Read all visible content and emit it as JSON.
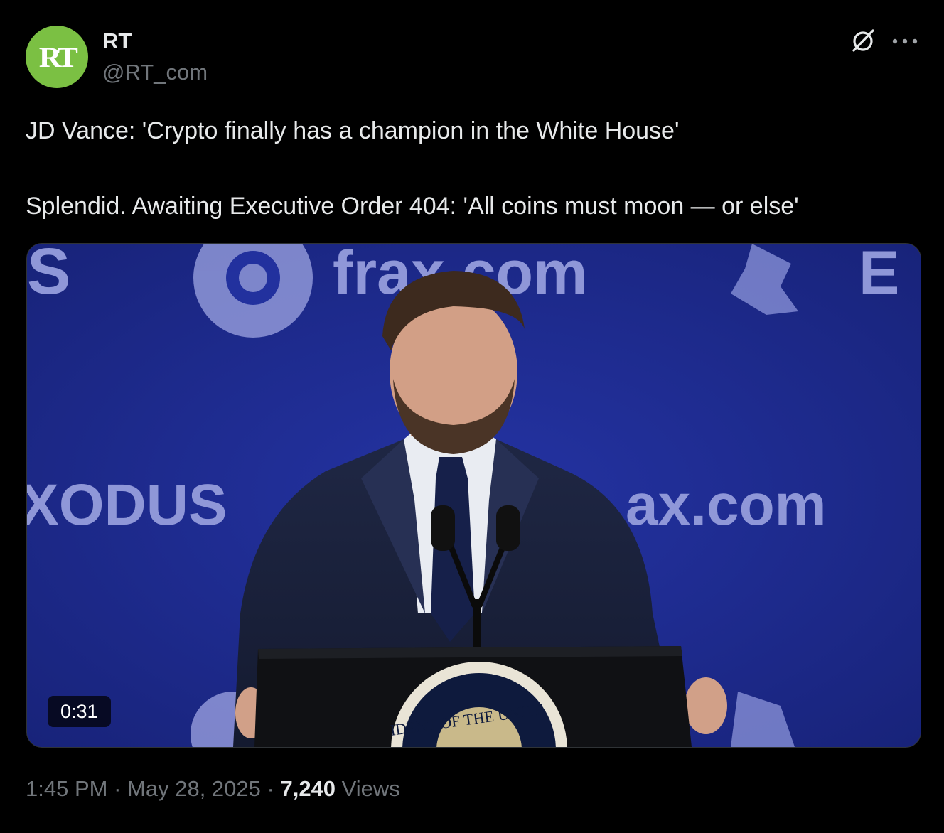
{
  "author": {
    "avatar_text": "RT",
    "name": "RT",
    "handle": "@RT_com",
    "avatar_color": "#7bc043"
  },
  "header_icons": [
    "grok-icon",
    "more-icon"
  ],
  "tweet": {
    "line1": "JD Vance: 'Crypto finally has a champion in the White House'",
    "line2": "Splendid. Awaiting Executive Order 404: 'All coins must moon — or else'"
  },
  "media": {
    "duration": "0:31",
    "backdrop_color": "#1e2b8c",
    "backdrop_texts": {
      "top_left": "S",
      "top_center": "frax.com",
      "top_right": "E",
      "mid_left": "XODUS",
      "mid_right": "ax.com",
      "seal": "IDENT OF THE UNITE"
    }
  },
  "meta": {
    "time": "1:45 PM",
    "separator": "·",
    "date": "May 28, 2025",
    "views_count": "7,240",
    "views_label": "Views"
  },
  "colors": {
    "background": "#000000",
    "text_primary": "#e7e9ea",
    "text_secondary": "#71767b",
    "border": "#2f3336"
  }
}
